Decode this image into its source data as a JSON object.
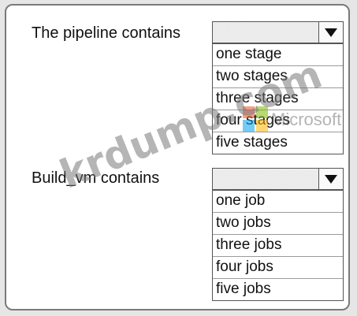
{
  "questions": [
    {
      "label": "The pipeline contains",
      "options": [
        "one stage",
        "two stages",
        "three stages",
        "four stages",
        "five stages"
      ]
    },
    {
      "label": "Build_vm contains",
      "options": [
        "one job",
        "two jobs",
        "three jobs",
        "four jobs",
        "five jobs"
      ]
    }
  ],
  "watermark": {
    "text": "krdump.com",
    "logo_text": "Microsoft",
    "logo_colors": [
      "#f25022",
      "#7fba00",
      "#00a4ef",
      "#ffb900"
    ]
  },
  "icons": {
    "dropdown_arrow": "triangle-down-icon"
  }
}
